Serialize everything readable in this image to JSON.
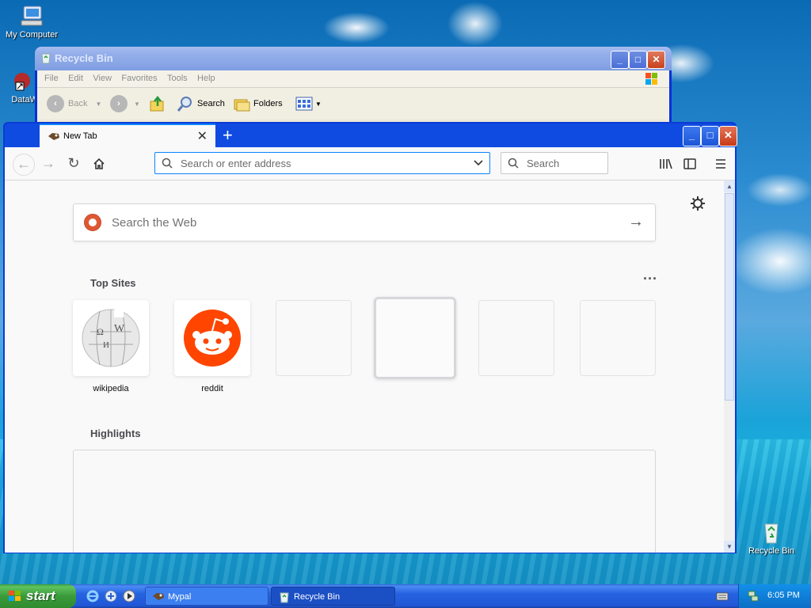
{
  "desktop": {
    "icons": [
      {
        "label": "My Computer"
      },
      {
        "label": "DataWa"
      },
      {
        "label": "Recycle Bin"
      }
    ]
  },
  "explorer": {
    "title": "Recycle Bin",
    "menu": [
      "File",
      "Edit",
      "View",
      "Favorites",
      "Tools",
      "Help"
    ],
    "toolbar": {
      "back": "Back",
      "search": "Search",
      "folders": "Folders"
    }
  },
  "firefox": {
    "tab": {
      "label": "New Tab"
    },
    "urlbar": {
      "placeholder": "Search or enter address"
    },
    "searchbar": {
      "placeholder": "Search"
    },
    "page_search": {
      "placeholder": "Search the Web"
    },
    "top_sites": {
      "title": "Top Sites",
      "tiles": [
        {
          "label": "wikipedia"
        },
        {
          "label": "reddit"
        }
      ]
    },
    "highlights": {
      "title": "Highlights"
    }
  },
  "taskbar": {
    "start": "start",
    "tasks": [
      "Mypal",
      "Recycle Bin"
    ],
    "clock": "6:05 PM"
  },
  "colors": {
    "accent": "#0a84ff",
    "xp_blue": "#0831d9",
    "reddit": "#ff4500",
    "ddg": "#de5833"
  }
}
